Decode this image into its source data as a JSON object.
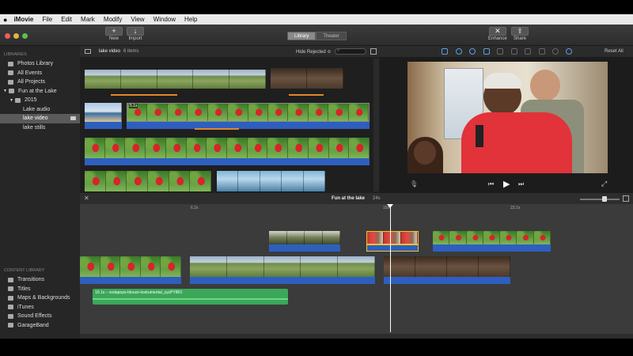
{
  "menubar": {
    "app": "iMovie",
    "items": [
      "File",
      "Edit",
      "Mark",
      "Modify",
      "View",
      "Window",
      "Help"
    ]
  },
  "toolbar": {
    "new": "New",
    "import": "Import",
    "library_tab": "Library",
    "theater_tab": "Theater",
    "enhance": "Enhance",
    "share": "Share"
  },
  "sidebar": {
    "libraries_heading": "LIBRARIES",
    "items": [
      {
        "label": "Photos Library"
      },
      {
        "label": "All Events"
      },
      {
        "label": "All Projects"
      },
      {
        "label": "Fun at the Lake"
      },
      {
        "label": "2015"
      },
      {
        "label": "Lake audio"
      },
      {
        "label": "lake video"
      },
      {
        "label": "lake stills"
      }
    ],
    "content_heading": "CONTENT LIBRARY",
    "content_items": [
      {
        "label": "Transitions"
      },
      {
        "label": "Titles"
      },
      {
        "label": "Maps & Backgrounds"
      },
      {
        "label": "iTunes"
      },
      {
        "label": "Sound Effects"
      },
      {
        "label": "GarageBand"
      }
    ]
  },
  "browser": {
    "event_name": "lake video",
    "item_count": "6 items",
    "filter": "Hide Rejected ≎",
    "clip_badge": "5.1s"
  },
  "viewer": {
    "reset_all": "Reset All"
  },
  "timeline": {
    "project": "Fun at the lake",
    "duration": "24s",
    "markers": [
      "6.2s",
      "15s",
      "23.1s"
    ],
    "audio_clip": "10.1s – sodapops-blooze-instrumental_zyzPYIBO"
  }
}
